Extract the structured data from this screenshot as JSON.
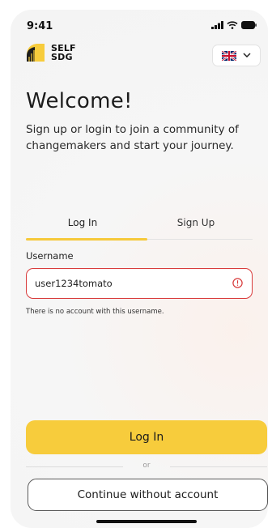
{
  "status_bar": {
    "time": "9:41"
  },
  "brand": {
    "line1": "SELF",
    "line2": "SDG"
  },
  "language": {
    "selected": "English (UK)",
    "flag_icon": "uk-flag-icon"
  },
  "welcome": {
    "title": "Welcome!",
    "subtitle": "Sign up or login to join a community of changemakers and start your journey."
  },
  "tabs": {
    "login": "Log In",
    "signup": "Sign Up",
    "active": "login"
  },
  "form": {
    "username_label": "Username",
    "username_value": "user1234tomato",
    "error_message": "There is no account with this username."
  },
  "actions": {
    "login_label": "Log In",
    "divider_text": "or",
    "guest_label": "Continue without account"
  },
  "colors": {
    "accent": "#f7cc3c",
    "error": "#d83a3a"
  }
}
